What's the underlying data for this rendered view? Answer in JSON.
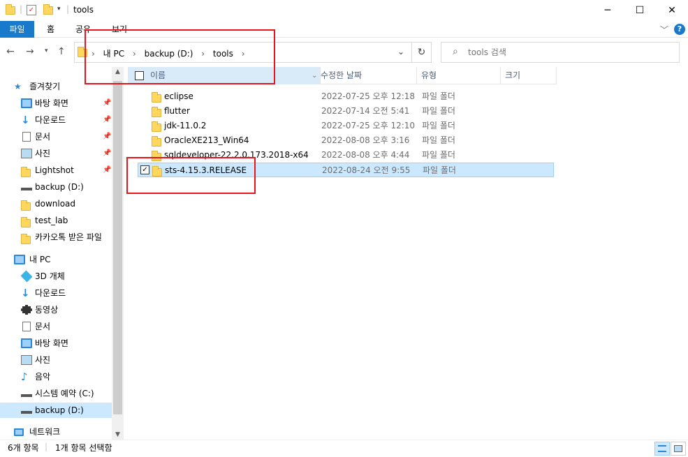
{
  "window": {
    "title": "tools",
    "minimize": "─",
    "maximize": "☐",
    "close": "✕"
  },
  "ribbon": {
    "tabs": [
      "파일",
      "홈",
      "공유",
      "보기"
    ]
  },
  "address": {
    "segments": [
      "내 PC",
      "backup (D:)",
      "tools"
    ]
  },
  "search": {
    "placeholder": "tools 검색"
  },
  "sidebar": {
    "quick_access": "즐겨찾기",
    "quick_items": [
      {
        "label": "바탕 화면",
        "icon": "desktop-icon"
      },
      {
        "label": "다운로드",
        "icon": "download-icon"
      },
      {
        "label": "문서",
        "icon": "document-icon"
      },
      {
        "label": "사진",
        "icon": "pictures-icon"
      },
      {
        "label": "Lightshot",
        "icon": "folder-icon"
      },
      {
        "label": "backup (D:)",
        "icon": "drive-icon"
      },
      {
        "label": "download",
        "icon": "folder-icon"
      },
      {
        "label": "test_lab",
        "icon": "folder-icon"
      },
      {
        "label": "카카오톡 받은 파일",
        "icon": "folder-icon"
      }
    ],
    "this_pc": "내 PC",
    "pc_items": [
      {
        "label": "3D 개체",
        "icon": "3d-objects-icon"
      },
      {
        "label": "다운로드",
        "icon": "download-icon"
      },
      {
        "label": "동영상",
        "icon": "video-icon"
      },
      {
        "label": "문서",
        "icon": "document-icon"
      },
      {
        "label": "바탕 화면",
        "icon": "desktop-icon"
      },
      {
        "label": "사진",
        "icon": "pictures-icon"
      },
      {
        "label": "음악",
        "icon": "music-icon"
      },
      {
        "label": "시스템 예약 (C:)",
        "icon": "drive-icon"
      },
      {
        "label": "backup (D:)",
        "icon": "drive-icon"
      }
    ],
    "network": "네트워크"
  },
  "columns": {
    "name": "이름",
    "date": "수정한 날짜",
    "type": "유형",
    "size": "크기"
  },
  "files": [
    {
      "name": "eclipse",
      "date": "2022-07-25 오후 12:18",
      "type": "파일 폴더"
    },
    {
      "name": "flutter",
      "date": "2022-07-14 오전 5:41",
      "type": "파일 폴더"
    },
    {
      "name": "jdk-11.0.2",
      "date": "2022-07-25 오후 12:10",
      "type": "파일 폴더"
    },
    {
      "name": "OracleXE213_Win64",
      "date": "2022-08-08 오후 3:16",
      "type": "파일 폴더"
    },
    {
      "name": "sqldeveloper-22.2.0.173.2018-x64",
      "date": "2022-08-08 오후 4:44",
      "type": "파일 폴더"
    },
    {
      "name": "sts-4.15.3.RELEASE",
      "date": "2022-08-24 오전 9:55",
      "type": "파일 폴더"
    }
  ],
  "status": {
    "count": "6개 항목",
    "selected": "1개 항목 선택함"
  },
  "colors": {
    "accent": "#1979ca",
    "selection": "#cce8ff",
    "annotation": "#e8131b"
  }
}
